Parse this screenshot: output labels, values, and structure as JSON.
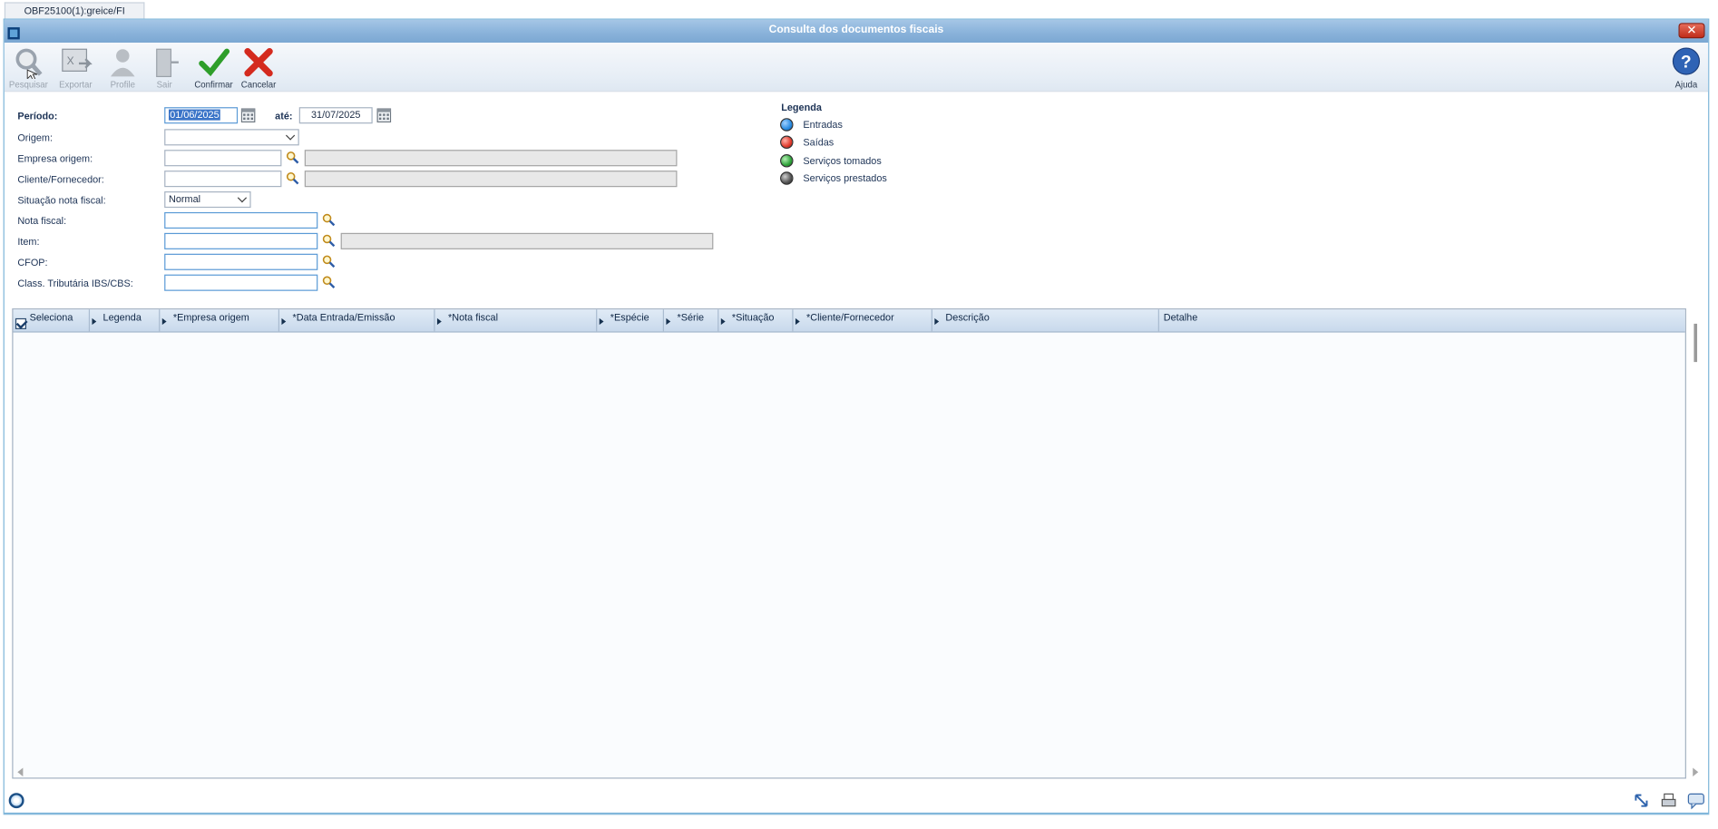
{
  "top_tab": {
    "label": "OBF25100(1):greice/FI"
  },
  "window": {
    "title": "Consulta dos documentos fiscais"
  },
  "toolbar": {
    "pesquisar": "Pesquisar",
    "exportar": "Exportar",
    "profile": "Profile",
    "sair": "Sair",
    "confirmar": "Confirmar",
    "cancelar": "Cancelar",
    "ajuda": "Ajuda"
  },
  "form": {
    "periodo_label": "Período:",
    "periodo_de": "01/06/2025",
    "ate_label": "até:",
    "periodo_ate": "31/07/2025",
    "origem_label": "Origem:",
    "origem_value": "",
    "empresa_origem_label": "Empresa origem:",
    "cliente_fornecedor_label": "Cliente/Fornecedor:",
    "situacao_label": "Situação nota fiscal:",
    "situacao_value": "Normal",
    "nota_fiscal_label": "Nota fiscal:",
    "item_label": "Item:",
    "cfop_label": "CFOP:",
    "class_trib_label": "Class. Tributária IBS/CBS:"
  },
  "legend": {
    "title": "Legenda",
    "items": [
      {
        "label": "Entradas",
        "color": "#2a8be0"
      },
      {
        "label": "Saídas",
        "color": "#e03a2c"
      },
      {
        "label": "Serviços tomados",
        "color": "#2fa33a"
      },
      {
        "label": "Serviços prestados",
        "color": "#555555"
      }
    ]
  },
  "grid": {
    "columns": [
      "Seleciona",
      "Legenda",
      "*Empresa origem",
      "*Data Entrada/Emissão",
      "*Nota fiscal",
      "*Espécie",
      "*Série",
      "*Situação",
      "*Cliente/Fornecedor",
      "Descrição",
      "Detalhe"
    ],
    "rows": []
  }
}
